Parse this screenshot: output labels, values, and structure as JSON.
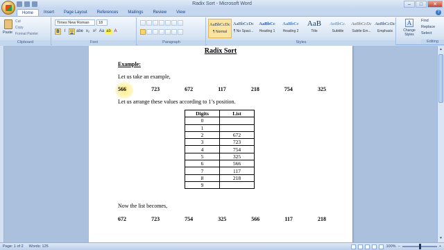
{
  "window": {
    "title": "Radix Sort - Microsoft Word",
    "minimize": "–",
    "maximize": "□",
    "close": "✕"
  },
  "tabs": [
    "Home",
    "Insert",
    "Page Layout",
    "References",
    "Mailings",
    "Review",
    "View"
  ],
  "ribbon": {
    "clipboard": {
      "paste": "Paste",
      "cut": "Cut",
      "copy": "Copy",
      "format_painter": "Format Painter",
      "label": "Clipboard"
    },
    "font": {
      "name": "Times New Roman",
      "size": "18",
      "label": "Font",
      "bold": "B",
      "italic": "I",
      "underline": "U",
      "strike": "abe",
      "sub": "x₂",
      "sup": "x²",
      "case": "Aa",
      "highlight": "ab",
      "color": "A"
    },
    "paragraph": {
      "label": "Paragraph"
    },
    "styles": {
      "label": "Styles",
      "items": [
        {
          "preview": "AaBbCcDc",
          "name": "¶ Normal"
        },
        {
          "preview": "AaBbCcDc",
          "name": "¶ No Spaci..."
        },
        {
          "preview": "AaBbCc",
          "name": "Heading 1"
        },
        {
          "preview": "AaBbCc",
          "name": "Heading 2"
        },
        {
          "preview": "AaB",
          "name": "Title"
        },
        {
          "preview": "AaBbCc.",
          "name": "Subtitle"
        },
        {
          "preview": "AaBbCcDc",
          "name": "Subtle Em..."
        },
        {
          "preview": "AaBbCcDc",
          "name": "Emphasis"
        }
      ],
      "change_styles": "Change Styles"
    },
    "editing": {
      "find": "Find",
      "replace": "Replace",
      "select": "Select",
      "label": "Editing"
    }
  },
  "document": {
    "heading": "Radix Sort",
    "example_label": "Example:",
    "intro": "Let us take an example,",
    "numbers": [
      "566",
      "723",
      "672",
      "117",
      "218",
      "754",
      "325"
    ],
    "arrange_text": "Let us arrange these values according to 1’s position.",
    "table": {
      "headers": [
        "Digits",
        "List"
      ],
      "rows": [
        [
          "0",
          ""
        ],
        [
          "1",
          ""
        ],
        [
          "2",
          "672"
        ],
        [
          "3",
          "723"
        ],
        [
          "4",
          "754"
        ],
        [
          "5",
          "325"
        ],
        [
          "6",
          "566"
        ],
        [
          "7",
          "117"
        ],
        [
          "8",
          "218"
        ],
        [
          "9",
          ""
        ]
      ]
    },
    "now_text": "Now the list becomes,",
    "new_numbers": [
      "672",
      "723",
      "754",
      "325",
      "566",
      "117",
      "218"
    ]
  },
  "status": {
    "page": "Page: 1 of 2",
    "words": "Words: 125",
    "zoom": "100%"
  }
}
